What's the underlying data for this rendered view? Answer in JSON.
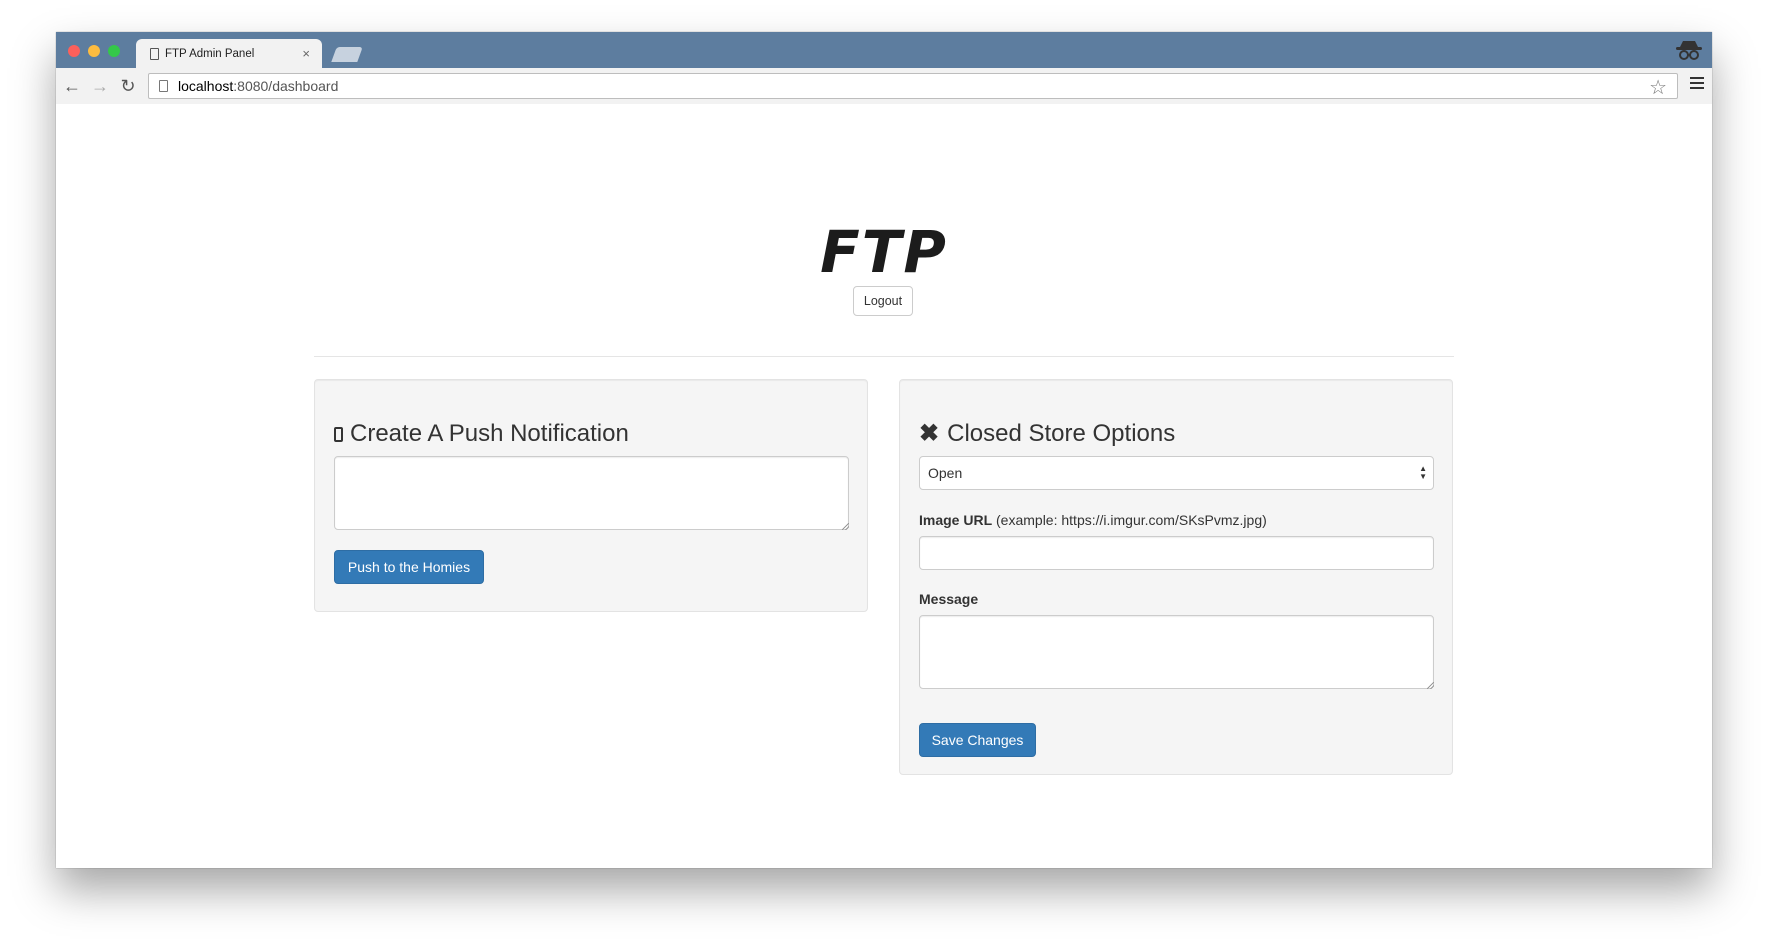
{
  "browser": {
    "tab_title": "FTP Admin Panel",
    "tab_close": "×",
    "url_host": "localhost",
    "url_path": ":8080/dashboard"
  },
  "header": {
    "logo": "FTP",
    "logout_label": "Logout"
  },
  "push_panel": {
    "title": "Create A Push Notification",
    "textarea_value": "",
    "button_label": "Push to the Homies"
  },
  "store_panel": {
    "title": "Closed Store Options",
    "select_value": "Open",
    "image_url_label": "Image URL",
    "image_url_hint": " (example: https://i.imgur.com/SKsPvmz.jpg)",
    "image_url_value": "",
    "message_label": "Message",
    "message_value": "",
    "save_label": "Save Changes"
  },
  "colors": {
    "primary": "#337ab7",
    "titlebar": "#5d7d9f",
    "panel_bg": "#f5f5f5"
  }
}
